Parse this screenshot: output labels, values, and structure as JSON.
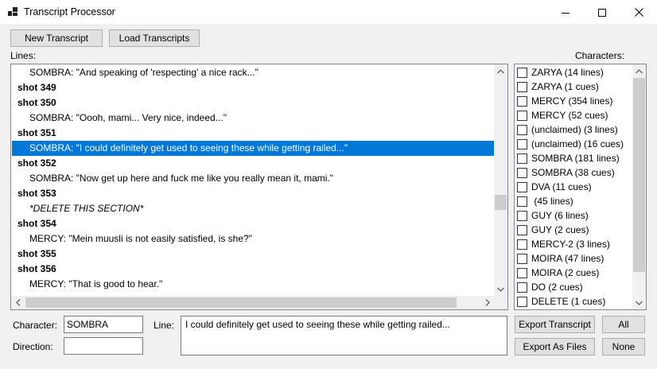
{
  "window": {
    "title": "Transcript Processor"
  },
  "toolbar": {
    "new_label": "New Transcript",
    "load_label": "Load Transcripts"
  },
  "lines_panel": {
    "label": "Lines:",
    "rows": [
      {
        "text": "SOMBRA: \"And speaking of 'respecting' a nice rack...\"",
        "kind": "dialogue"
      },
      {
        "text": "shot 349",
        "kind": "shot"
      },
      {
        "text": "shot 350",
        "kind": "shot"
      },
      {
        "text": "SOMBRA: \"Oooh, mami... Very nice, indeed...\"",
        "kind": "dialogue"
      },
      {
        "text": "shot 351",
        "kind": "shot"
      },
      {
        "text": "SOMBRA: \"I could definitely get used to seeing these while getting railed...\"",
        "kind": "dialogue",
        "selected": true
      },
      {
        "text": "shot 352",
        "kind": "shot"
      },
      {
        "text": "SOMBRA: \"Now get up here and fuck me like you really mean it, mami.\"",
        "kind": "dialogue"
      },
      {
        "text": "shot 353",
        "kind": "shot"
      },
      {
        "text": "*DELETE THIS SECTION*",
        "kind": "direction"
      },
      {
        "text": "shot 354",
        "kind": "shot"
      },
      {
        "text": "MERCY: \"Mein muusli is not easily satisfied, is she?\"",
        "kind": "dialogue"
      },
      {
        "text": "shot 355",
        "kind": "shot"
      },
      {
        "text": "shot 356",
        "kind": "shot"
      },
      {
        "text": "MERCY: \"That is good to hear.\"",
        "kind": "dialogue"
      }
    ],
    "scroll_position": 0.9
  },
  "characters_panel": {
    "label": "Characters:",
    "items": [
      {
        "label": "ZARYA (14 lines)",
        "checked": false
      },
      {
        "label": "ZARYA (1 cues)",
        "checked": false
      },
      {
        "label": "MERCY (354 lines)",
        "checked": false
      },
      {
        "label": "MERCY (52 cues)",
        "checked": false
      },
      {
        "label": "(unclaimed) (3 lines)",
        "checked": false
      },
      {
        "label": "(unclaimed) (16 cues)",
        "checked": false
      },
      {
        "label": "SOMBRA (181 lines)",
        "checked": false
      },
      {
        "label": "SOMBRA (38 cues)",
        "checked": false
      },
      {
        "label": "DVA (11 cues)",
        "checked": false
      },
      {
        "label": " (45 lines)",
        "checked": false
      },
      {
        "label": "GUY (6 lines)",
        "checked": false
      },
      {
        "label": "GUY (2 cues)",
        "checked": false
      },
      {
        "label": "MERCY-2 (3 lines)",
        "checked": false
      },
      {
        "label": "MOIRA (47 lines)",
        "checked": false
      },
      {
        "label": "MOIRA (2 cues)",
        "checked": false
      },
      {
        "label": "DO (2 cues)",
        "checked": false
      },
      {
        "label": "DELETE (1 cues)",
        "checked": false
      }
    ]
  },
  "editor": {
    "character_label": "Character:",
    "character_value": "SOMBRA",
    "direction_label": "Direction:",
    "direction_value": "",
    "line_label": "Line:",
    "line_value": "I could definitely get used to seeing these while getting railed..."
  },
  "actions": {
    "export_transcript": "Export Transcript",
    "export_files": "Export As Files",
    "all": "All",
    "none": "None"
  },
  "icons": {
    "app": "app-window-icon",
    "minimize": "minimize-icon",
    "maximize": "maximize-icon",
    "close": "close-icon",
    "scroll_up": "scroll-up-arrow-icon",
    "scroll_down": "scroll-down-arrow-icon",
    "scroll_left": "scroll-left-arrow-icon",
    "scroll_right": "scroll-right-arrow-icon"
  },
  "colors": {
    "selection": "#0078d7",
    "window_bg": "#f0f0f0",
    "button_bg": "#e1e1e1"
  }
}
